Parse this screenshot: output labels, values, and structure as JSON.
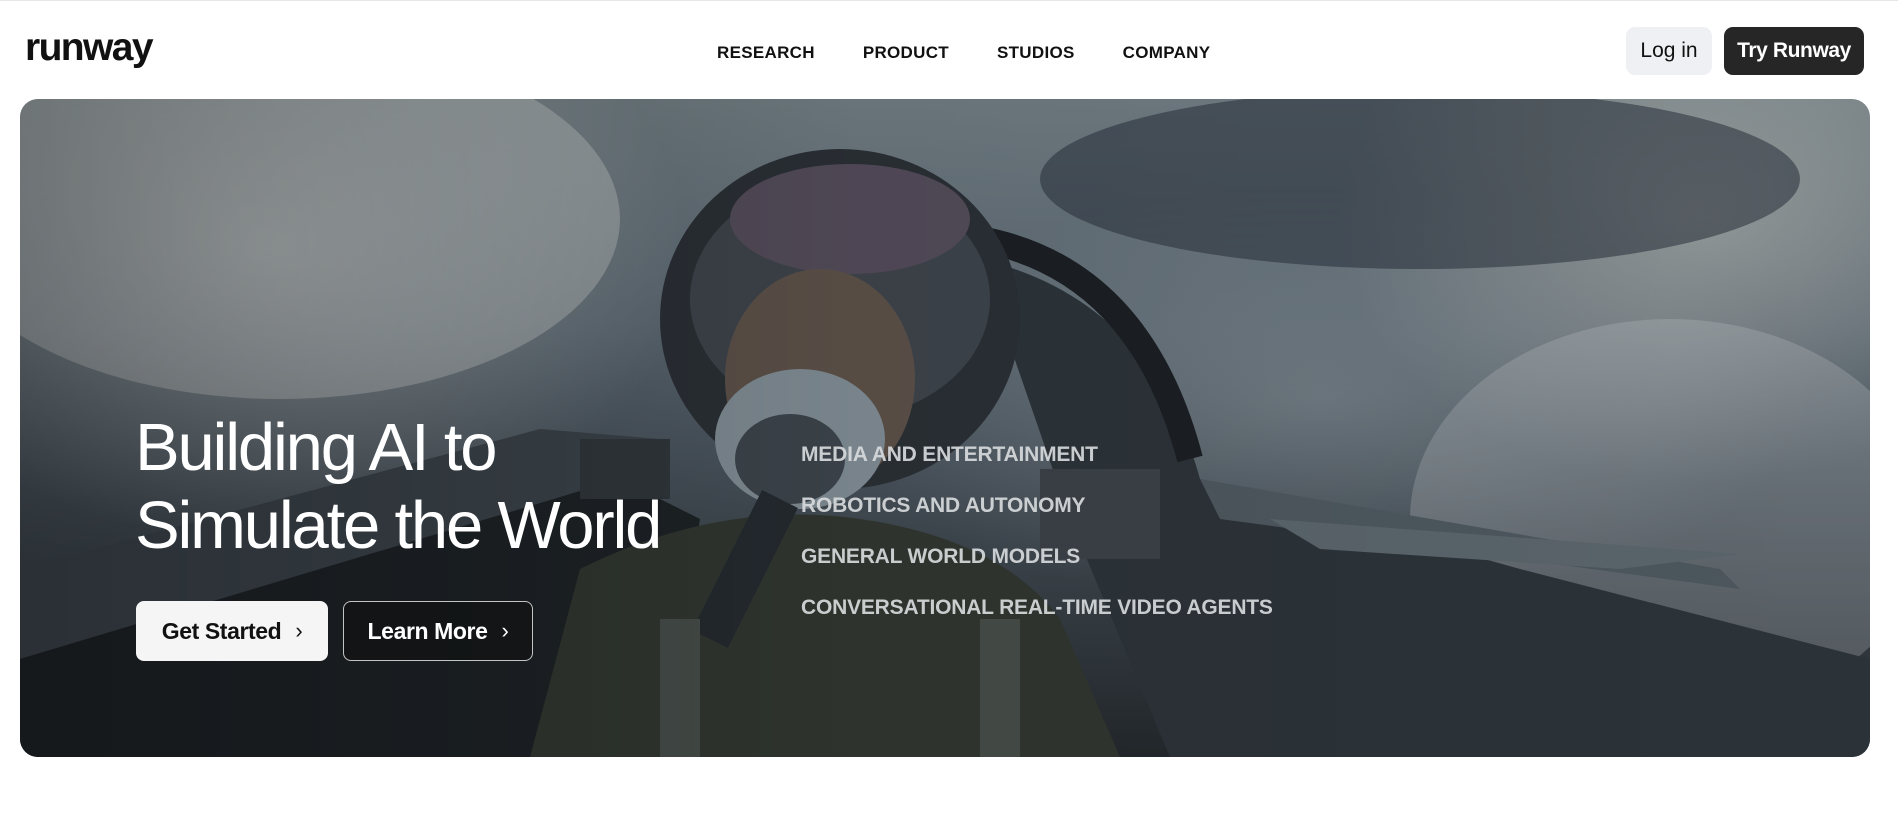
{
  "header": {
    "logo": "runway",
    "nav": [
      "RESEARCH",
      "PRODUCT",
      "STUDIOS",
      "COMPANY"
    ],
    "login_label": "Log in",
    "try_label": "Try Runway"
  },
  "hero": {
    "headline_line1": "Building AI to",
    "headline_line2": "Simulate the World",
    "get_started_label": "Get Started",
    "learn_more_label": "Learn More",
    "chevron": "›",
    "sectors": [
      "MEDIA AND ENTERTAINMENT",
      "ROBOTICS AND AUTONOMY",
      "GENERAL WORLD MODELS",
      "CONVERSATIONAL REAL-TIME VIDEO AGENTS"
    ]
  },
  "colors": {
    "try_button_bg": "#262626",
    "login_button_bg": "#eef0f3"
  },
  "icons": [
    "chevron-right-icon"
  ]
}
